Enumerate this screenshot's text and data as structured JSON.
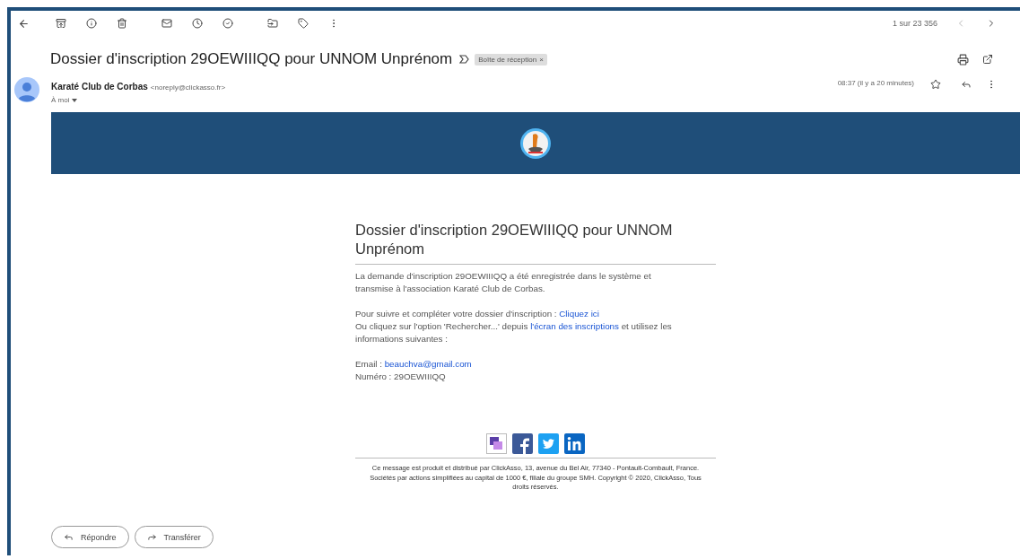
{
  "toolbar": {
    "pager": "1 sur 23 356"
  },
  "subject": {
    "title": "Dossier d'inscription 29OEWIIIQQ pour UNNOM Unprénom",
    "label": "Boîte de réception",
    "label_close": "×"
  },
  "sender": {
    "name": "Karaté Club de Corbas",
    "address": "<noreply@clickasso.fr>",
    "recipient": "À moi",
    "time": "08:37 (il y a 20 minutes)",
    "starred": false
  },
  "message": {
    "title": "Dossier d'inscription 29OEWIIIQQ pour UNNOM Unprénom",
    "paragraphs": [
      {
        "lines": [
          [
            {
              "kind": "text",
              "text": "La demande d'inscription 29OEWIIIQQ a été enregistrée dans le système et transmise à l'association Karaté Club de Corbas."
            }
          ]
        ]
      },
      {
        "lines": [
          [
            {
              "kind": "text",
              "text": "Pour suivre et compléter votre dossier d'inscription : "
            },
            {
              "kind": "link",
              "text": "Cliquez ici"
            }
          ],
          [
            {
              "kind": "text",
              "text": "Ou cliquez sur l'option 'Rechercher...' depuis "
            },
            {
              "kind": "link",
              "text": "l'écran des inscriptions"
            },
            {
              "kind": "text",
              "text": " et utilisez les informations suivantes :"
            }
          ]
        ]
      },
      {
        "lines": [
          [
            {
              "kind": "text",
              "text": "Email : "
            },
            {
              "kind": "link",
              "text": "beauchva@gmail.com"
            }
          ],
          [
            {
              "kind": "text",
              "text": "Numéro : 29OEWIIIQQ"
            }
          ]
        ]
      }
    ],
    "social": [
      {
        "kind": "clickasso"
      },
      {
        "kind": "facebook"
      },
      {
        "kind": "twitter"
      },
      {
        "kind": "linkedin"
      }
    ],
    "footer": "Ce message est produit et distribué par ClickAsso, 13, avenue du Bel Air, 77340 - Pontault-Combault, France. Sociétés par actions simplifiées au capital de 1000 €, filiale du groupe SMH. Copyright © 2020, ClickAsso, Tous droits réservés."
  },
  "actions": [
    {
      "kind": "reply",
      "label": "Répondre"
    },
    {
      "kind": "forward",
      "label": "Transférer"
    }
  ]
}
